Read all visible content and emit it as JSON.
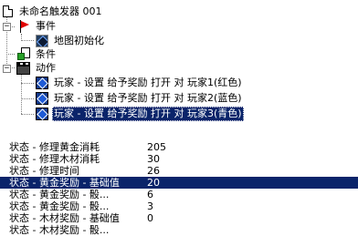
{
  "tree": {
    "root": {
      "label": "未命名触发器 001",
      "icon": "document-icon"
    },
    "events": {
      "label": "事件",
      "icon": "red-flag-icon",
      "items": [
        {
          "label": "地图初始化",
          "icon": "event-icon"
        }
      ]
    },
    "conditions": {
      "label": "条件",
      "icon": "condition-icon"
    },
    "actions": {
      "label": "动作",
      "icon": "action-icon",
      "items": [
        {
          "label": "玩家 - 设置 给予奖励 打开 对 玩家1(红色)"
        },
        {
          "label": "玩家 - 设置 给予奖励 打开 对 玩家2(蓝色)"
        },
        {
          "label": "玩家 - 设置 给予奖励 打开 对 玩家3(青色)",
          "selected": true
        }
      ]
    }
  },
  "properties": [
    {
      "key": "状态 - 修理黄金消耗",
      "value": "205"
    },
    {
      "key": "状态 - 修理木材消耗",
      "value": "30"
    },
    {
      "key": "状态 - 修理时间",
      "value": "26"
    },
    {
      "key": "状态 - 黄金奖励 - 基础值",
      "value": "20",
      "highlighted": true
    },
    {
      "key": "状态 - 黄金奖励 - 骰...",
      "value": "6"
    },
    {
      "key": "状态 - 黄金奖励 - 骰...",
      "value": "3"
    },
    {
      "key": "状态 - 木材奖励 - 基础值",
      "value": "0"
    },
    {
      "key": "状态 - 木材奖励 - 骰...",
      "value": ""
    }
  ],
  "colors": {
    "selection": "#0a246a",
    "flag": "#e00000"
  }
}
